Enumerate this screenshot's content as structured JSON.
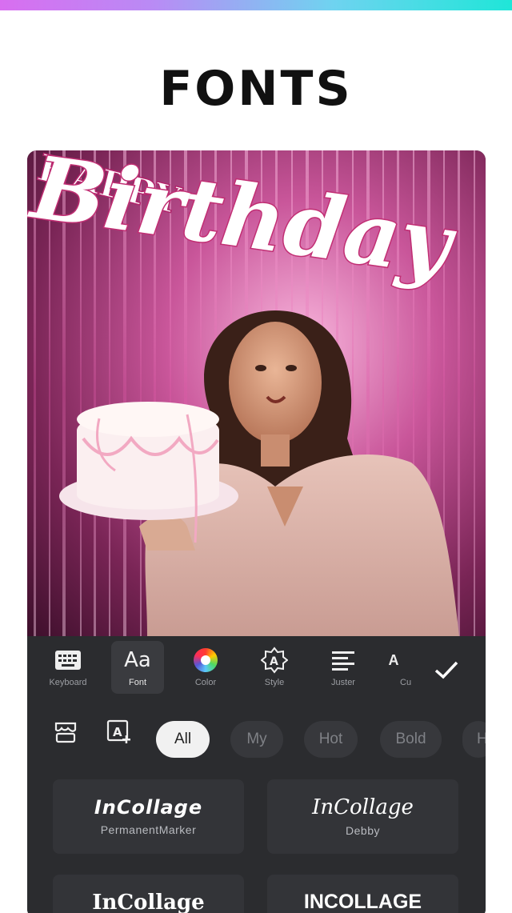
{
  "page": {
    "heading": "FONTS"
  },
  "artwork": {
    "happy_text": "HAPPY",
    "birthday_text": "Birthday"
  },
  "toolbar": {
    "tools": [
      {
        "label": "Keyboard",
        "icon": "keyboard-icon"
      },
      {
        "label": "Font",
        "icon": "font-aa-icon",
        "active": true
      },
      {
        "label": "Color",
        "icon": "color-wheel-icon"
      },
      {
        "label": "Style",
        "icon": "style-icon"
      },
      {
        "label": "Juster",
        "icon": "align-icon"
      },
      {
        "label": "Cu",
        "icon": "curve-text-icon"
      }
    ],
    "confirm_icon": "checkmark-icon",
    "font_glyph": "Aa"
  },
  "font_panel": {
    "icons": [
      "store-icon",
      "add-font-icon"
    ],
    "categories": [
      {
        "label": "All",
        "active": true
      },
      {
        "label": "My"
      },
      {
        "label": "Hot"
      },
      {
        "label": "Bold"
      },
      {
        "label": "H"
      }
    ],
    "fonts": [
      {
        "sample": "InCollage",
        "name": "PermanentMarker"
      },
      {
        "sample": "InCollage",
        "name": "Debby"
      },
      {
        "sample": "InCollage",
        "name": ""
      },
      {
        "sample": "INCOLLAGE",
        "name": ""
      }
    ]
  },
  "colors": {
    "accent_gradient": [
      "#d86ef0",
      "#1fe6d8"
    ],
    "panel_bg": "#2b2c2f",
    "pill_active": "#f1f1f1"
  }
}
